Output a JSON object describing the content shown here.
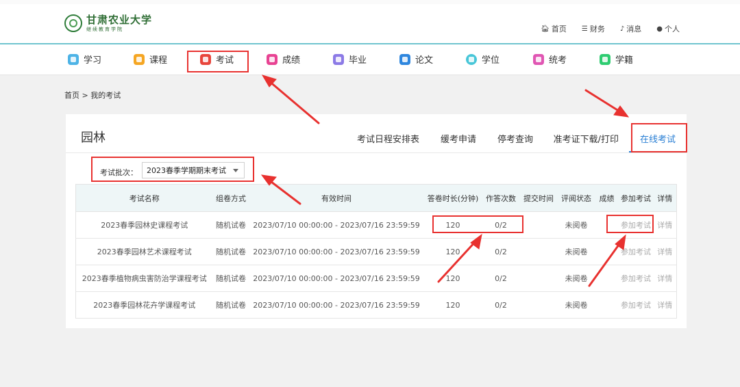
{
  "header": {
    "logo_text": "甘肃农业大学",
    "logo_subtext": "继续教育学院",
    "links": [
      {
        "label": "首页",
        "icon": "home-icon"
      },
      {
        "label": "财务",
        "icon": "database-icon"
      },
      {
        "label": "消息",
        "icon": "bell-icon"
      },
      {
        "label": "个人",
        "icon": "user-icon"
      }
    ]
  },
  "nav": {
    "items": [
      {
        "label": "学习",
        "color": "#4db3e6"
      },
      {
        "label": "课程",
        "color": "#f5a623"
      },
      {
        "label": "考试",
        "color": "#e8453c"
      },
      {
        "label": "成绩",
        "color": "#e84393"
      },
      {
        "label": "毕业",
        "color": "#8c7ae6"
      },
      {
        "label": "论文",
        "color": "#2e86de"
      },
      {
        "label": "学位",
        "color": "#48c6d8"
      },
      {
        "label": "统考",
        "color": "#e056b3"
      },
      {
        "label": "学籍",
        "color": "#2ecc71"
      }
    ]
  },
  "breadcrumb": "首页 > 我的考试",
  "card": {
    "title": "园林",
    "tabs": [
      "考试日程安排表",
      "缓考申请",
      "停考查询",
      "准考证下载/打印",
      "在线考试"
    ],
    "active_tab": "在线考试",
    "batch_label": "考试批次：",
    "batch_value": "2023春季学期期末考试"
  },
  "table": {
    "headers": [
      "考试名称",
      "组卷方式",
      "有效时间",
      "答卷时长(分钟)",
      "作答次数",
      "提交时间",
      "评阅状态",
      "成绩",
      "参加考试",
      "详情"
    ],
    "rows": [
      {
        "name": "2023春季园林史课程考试",
        "method": "随机试卷",
        "time": "2023/07/10 00:00:00 - 2023/07/16 23:59:59",
        "duration": "120",
        "attempts": "0/2",
        "submit": "",
        "status": "未阅卷",
        "score": "",
        "join": "参加考试",
        "detail": "详情"
      },
      {
        "name": "2023春季园林艺术课程考试",
        "method": "随机试卷",
        "time": "2023/07/10 00:00:00 - 2023/07/16 23:59:59",
        "duration": "120",
        "attempts": "0/2",
        "submit": "",
        "status": "未阅卷",
        "score": "",
        "join": "参加考试",
        "detail": "详情"
      },
      {
        "name": "2023春季植物病虫害防治学课程考试",
        "method": "随机试卷",
        "time": "2023/07/10 00:00:00 - 2023/07/16 23:59:59",
        "duration": "120",
        "attempts": "0/2",
        "submit": "",
        "status": "未阅卷",
        "score": "",
        "join": "参加考试",
        "detail": "详情"
      },
      {
        "name": "2023春季园林花卉学课程考试",
        "method": "随机试卷",
        "time": "2023/07/10 00:00:00 - 2023/07/16 23:59:59",
        "duration": "120",
        "attempts": "0/2",
        "submit": "",
        "status": "未阅卷",
        "score": "",
        "join": "参加考试",
        "detail": "详情"
      }
    ]
  },
  "colors": {
    "accent": "#2a7fd4",
    "annotation": "#e8312f",
    "header_line": "#6fc4cf"
  }
}
